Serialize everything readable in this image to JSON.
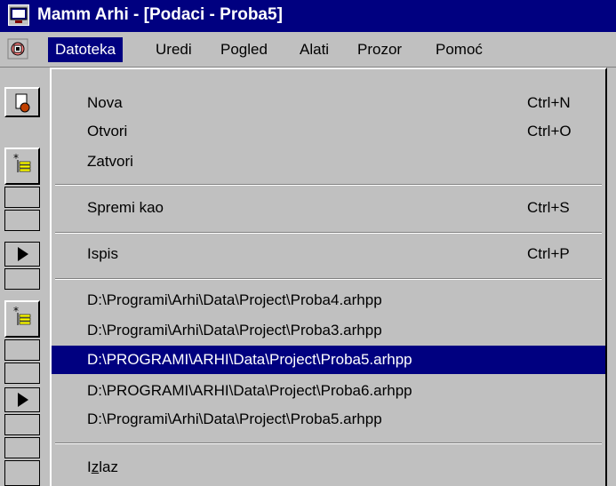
{
  "window": {
    "title": "Mamm Arhi - [Podaci - Proba5]"
  },
  "menubar": {
    "items": [
      {
        "label": "Datoteka"
      },
      {
        "label": "Uredi"
      },
      {
        "label": "Pogled"
      },
      {
        "label": "Alati"
      },
      {
        "label": "Prozor"
      },
      {
        "label": "Pomoć"
      }
    ]
  },
  "file_menu": {
    "items": [
      {
        "label": "Nova",
        "shortcut": "Ctrl+N"
      },
      {
        "label": "Otvori",
        "shortcut": "Ctrl+O"
      },
      {
        "label": "Zatvori",
        "shortcut": ""
      },
      {
        "label": "Spremi kao",
        "shortcut": "Ctrl+S"
      },
      {
        "label": "Ispis",
        "shortcut": "Ctrl+P"
      }
    ],
    "recent_files": [
      "D:\\Programi\\Arhi\\Data\\Project\\Proba4.arhpp",
      "D:\\Programi\\Arhi\\Data\\Project\\Proba3.arhpp",
      "D:\\PROGRAMI\\ARHI\\Data\\Project\\Proba5.arhpp",
      "D:\\PROGRAMI\\ARHI\\Data\\Project\\Proba6.arhpp",
      "D:\\Programi\\Arhi\\Data\\Project\\Proba5.arhpp"
    ],
    "exit_prefix": "I",
    "exit_accel": "z",
    "exit_rest": "laz"
  },
  "colors": {
    "titlebar": "#000080",
    "highlight": "#000080",
    "face": "#c0c0c0"
  },
  "icons": {
    "app": "app-window-icon",
    "document": "document-icon",
    "new_record": "new-record-icon",
    "play": "play-arrow-icon"
  }
}
